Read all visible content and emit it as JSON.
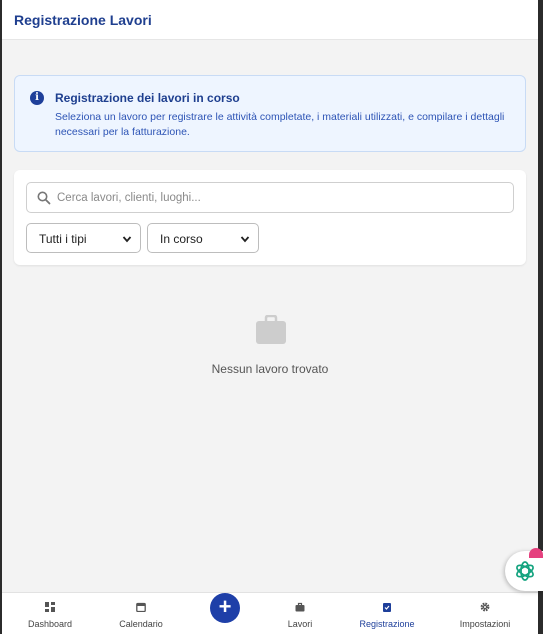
{
  "header": {
    "title": "Registrazione Lavori"
  },
  "info": {
    "icon": "info-icon",
    "title": "Registrazione dei lavori in corso",
    "text": "Seleziona un lavoro per registrare le attività completate, i materiali utilizzati, e compilare i dettagli necessari per la fatturazione."
  },
  "filters": {
    "search_placeholder": "Cerca lavori, clienti, luoghi...",
    "type_select": "Tutti i tipi",
    "status_select": "In corso"
  },
  "empty": {
    "icon": "briefcase-icon",
    "message": "Nessun lavoro trovato"
  },
  "fab": {
    "label": "+"
  },
  "nav": {
    "items": [
      {
        "label": "Dashboard",
        "icon": "dashboard-icon"
      },
      {
        "label": "Calendario",
        "icon": "calendar-icon"
      },
      {
        "label": "Lavori",
        "icon": "briefcase-icon"
      },
      {
        "label": "Registrazione",
        "icon": "clipboard-check-icon",
        "active": true
      },
      {
        "label": "Impostazioni",
        "icon": "gear-icon"
      }
    ]
  },
  "colors": {
    "accent": "#1e3fa8",
    "title": "#1f3f8f",
    "info_bg": "#eef5ff",
    "assistant": "#14a37f"
  }
}
